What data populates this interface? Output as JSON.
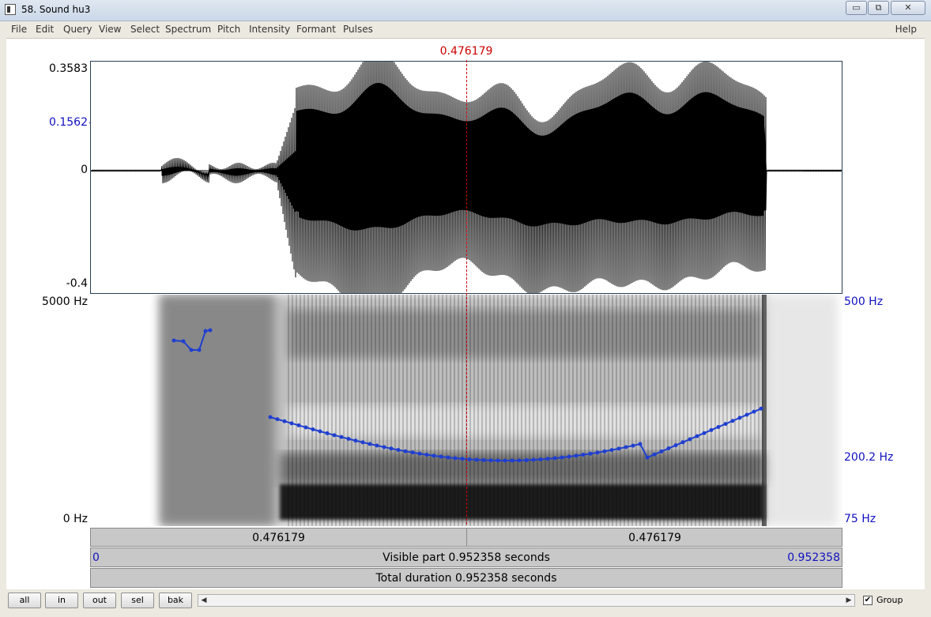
{
  "window": {
    "title": "58. Sound hu3",
    "minimize_glyph": "▭",
    "maximize_glyph": "⧉",
    "close_glyph": "✕"
  },
  "menu": {
    "items": [
      "File",
      "Edit",
      "Query",
      "View",
      "Select",
      "Spectrum",
      "Pitch",
      "Intensity",
      "Formant",
      "Pulses"
    ],
    "help": "Help"
  },
  "cursor": {
    "time": "0.476179",
    "color": "#cc0000"
  },
  "waveform": {
    "max_label": "0.3583",
    "cursor_value_label": "0.1562",
    "zero_label": "0",
    "min_label": "-0.4"
  },
  "spectrogram": {
    "freq_top_label": "5000 Hz",
    "freq_bottom_label": "0 Hz",
    "pitch_top_label": "500 Hz",
    "pitch_cursor_label": "200.2 Hz",
    "pitch_bottom_label": "75 Hz",
    "pitch_color": "#1f3fd0"
  },
  "bars": {
    "left_segment": "0.476179",
    "right_segment": "0.476179",
    "visible_start": "0",
    "visible_part": "Visible part 0.952358 seconds",
    "visible_end": "0.952358",
    "total_duration": "Total duration 0.952358 seconds"
  },
  "toolbar": {
    "buttons": [
      "all",
      "in",
      "out",
      "sel",
      "bak"
    ],
    "scroll_left": "◀",
    "scroll_right": "▶",
    "group_label": "Group",
    "group_checked": "✔"
  }
}
